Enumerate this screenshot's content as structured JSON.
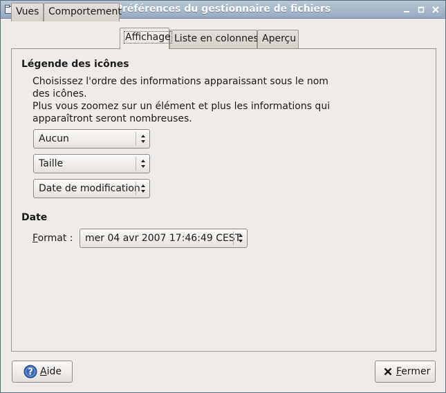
{
  "window": {
    "title": "Préférences du gestionnaire de fichiers"
  },
  "tabs": [
    {
      "label": "Vues",
      "active": false
    },
    {
      "label": "Comportement",
      "active": false
    },
    {
      "label": "Affichage",
      "active": true
    },
    {
      "label": "Liste en colonnes",
      "active": false
    },
    {
      "label": "Aperçu",
      "active": false
    }
  ],
  "captions": {
    "title": "Légende des icônes",
    "description_line1": "Choisissez l'ordre des informations apparaissant sous le nom",
    "description_line2": "des icônes.",
    "description_line3": "Plus vous zoomez sur un élément et plus les informations qui",
    "description_line4": "apparaîtront seront nombreuses.",
    "combo1": "Aucun",
    "combo2": "Taille",
    "combo3": "Date de modification"
  },
  "date": {
    "title": "Date",
    "format_mnemonic": "F",
    "format_rest": "ormat :",
    "format_value": "mer 04 avr 2007 17:46:49 CEST"
  },
  "buttons": {
    "help_mnemonic": "A",
    "help_rest": "ide",
    "close_mnemonic": "F",
    "close_rest": "ermer"
  },
  "colors": {
    "titlebar": "#97abc1",
    "background": "#efebe7",
    "help_icon": "#3b6bb5"
  }
}
